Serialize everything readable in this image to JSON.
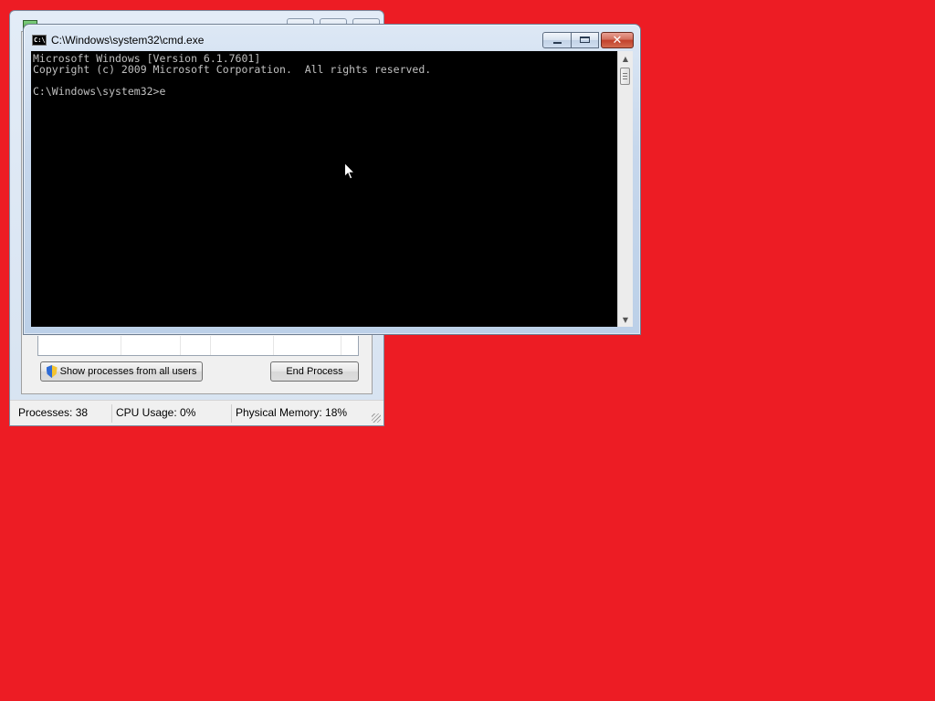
{
  "desktop": {
    "background_color": "#ed1c24"
  },
  "task_manager": {
    "show_all_users_label": "Show processes from all users",
    "end_process_label": "End Process",
    "status": {
      "processes": "Processes: 38",
      "cpu": "CPU Usage: 0%",
      "memory": "Physical Memory: 18%"
    }
  },
  "cmd_window": {
    "title": "C:\\Windows\\system32\\cmd.exe",
    "icon_text": "C:\\",
    "console_lines": [
      "Microsoft Windows [Version 6.1.7601]",
      "Copyright (c) 2009 Microsoft Corporation.  All rights reserved.",
      "",
      "C:\\Windows\\system32>e"
    ],
    "console_colors": {
      "background": "#000000",
      "text": "#c0c0c0"
    },
    "close_symbol": "✕"
  }
}
